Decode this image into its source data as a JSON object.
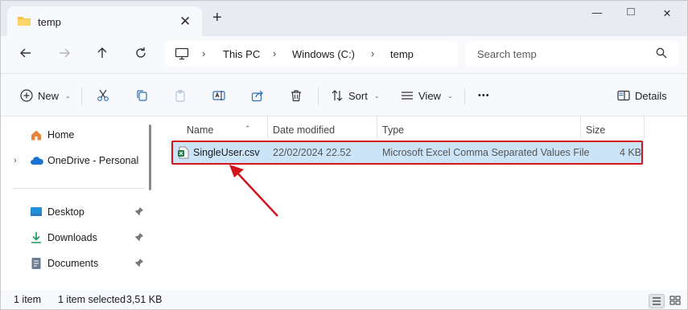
{
  "window": {
    "tab_title": "temp",
    "new_tab_symbol": "+",
    "close_tab_symbol": "✕",
    "controls": {
      "minimize": "—",
      "maximize": "□",
      "close": "✕"
    }
  },
  "navigation": {
    "breadcrumb": [
      "This PC",
      "Windows (C:)",
      "temp"
    ],
    "search_placeholder": "Search temp"
  },
  "commands": {
    "new": "New",
    "sort": "Sort",
    "view": "View",
    "more": "•••",
    "details": "Details"
  },
  "sidebar": {
    "items": [
      {
        "label": "Home",
        "icon": "home-icon"
      },
      {
        "label": "OneDrive - Personal",
        "icon": "cloud-icon"
      },
      {
        "label": "Desktop",
        "icon": "desktop-icon"
      },
      {
        "label": "Downloads",
        "icon": "download-icon"
      },
      {
        "label": "Documents",
        "icon": "documents-icon"
      }
    ]
  },
  "file_list": {
    "columns": [
      "Name",
      "Date modified",
      "Type",
      "Size"
    ],
    "rows": [
      {
        "name": "SingleUser.csv",
        "date": "22/02/2024 22.52",
        "type": "Microsoft Excel Comma Separated Values File",
        "size": "4 KB"
      }
    ]
  },
  "status": {
    "count": "1 item",
    "selected": "1 item selected",
    "size": "3,51 KB"
  },
  "annotation": {
    "color": "#d3141c"
  }
}
